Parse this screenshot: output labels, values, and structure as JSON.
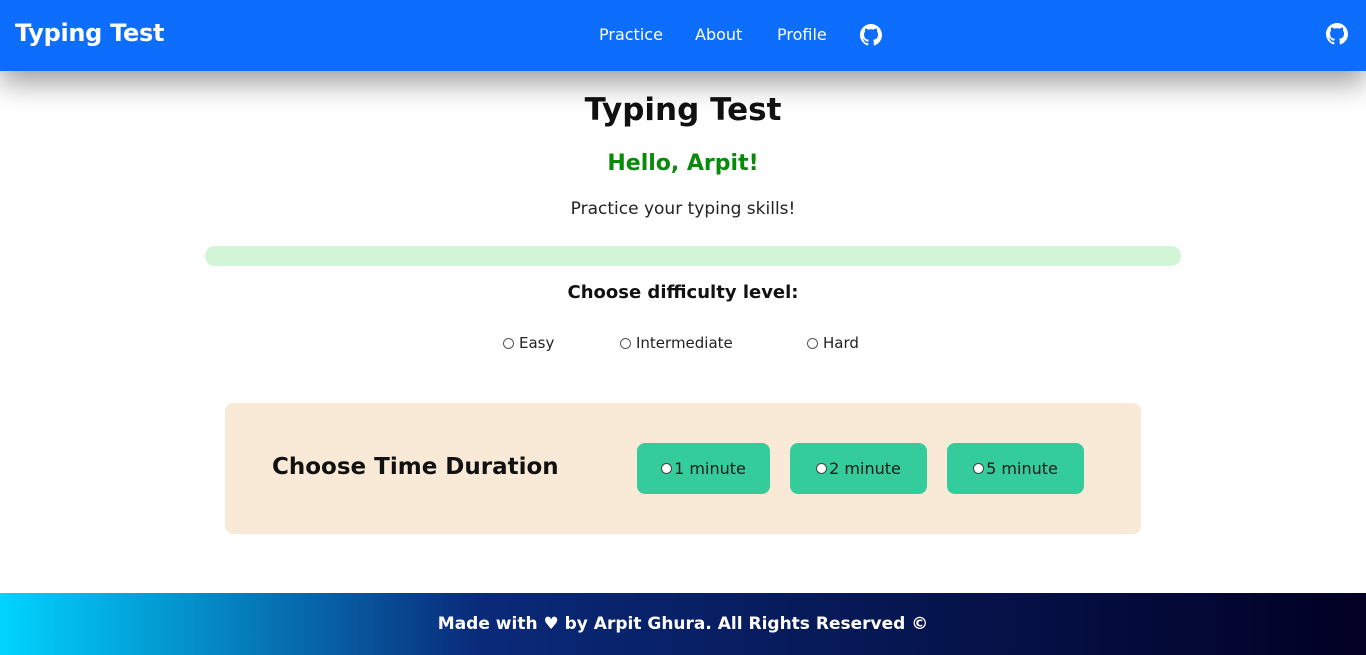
{
  "colors": {
    "navbar": "#0d6efd",
    "greeting": "#0a8a0a",
    "progress_track": "#d1f5d6",
    "progress_fill": "#28a745",
    "time_panel_bg": "#f8ead7",
    "time_button_bg": "#34cc9a",
    "footer_gradient_start": "#00d4ff",
    "footer_gradient_mid": "#0a2a7a",
    "footer_gradient_end": "#020024"
  },
  "navbar": {
    "brand": "Typing Test",
    "links": [
      {
        "label": "Practice"
      },
      {
        "label": "About"
      },
      {
        "label": "Profile"
      }
    ],
    "icons": [
      "github-icon",
      "github-icon"
    ]
  },
  "main": {
    "title": "Typing Test",
    "greeting": "Hello, Arpit!",
    "subtitle": "Practice your typing skills!",
    "progress": 0,
    "difficulty": {
      "heading": "Choose difficulty level:",
      "options": [
        {
          "label": "Easy",
          "checked": false
        },
        {
          "label": "Intermediate",
          "checked": false
        },
        {
          "label": "Hard",
          "checked": false
        }
      ]
    },
    "time": {
      "heading": "Choose Time Duration",
      "options": [
        {
          "label": "1 minute",
          "checked": false
        },
        {
          "label": "2 minute",
          "checked": false
        },
        {
          "label": "5 minute",
          "checked": false
        }
      ]
    }
  },
  "footer": {
    "text": "Made with ♥ by Arpit Ghura. All Rights Reserved ©"
  }
}
